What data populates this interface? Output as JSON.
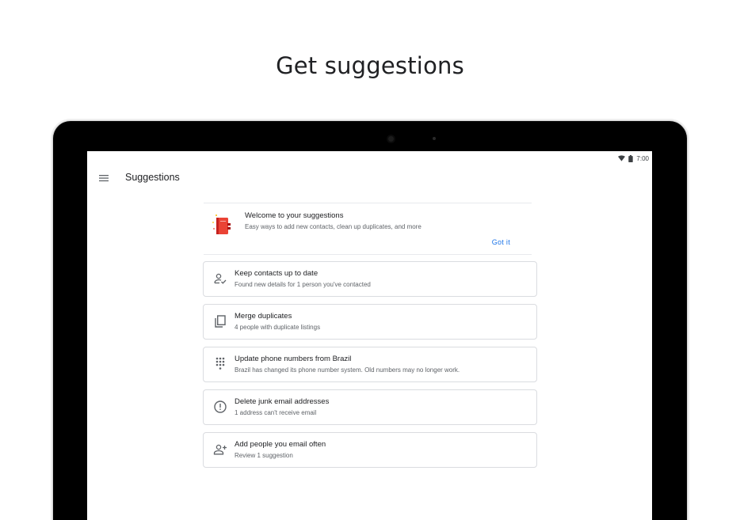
{
  "headline": "Get suggestions",
  "statusbar": {
    "time": "7:00",
    "icons": [
      "wifi-icon",
      "battery-icon"
    ]
  },
  "appbar": {
    "title": "Suggestions",
    "menu_icon": "menu-icon"
  },
  "welcome": {
    "title": "Welcome to your suggestions",
    "subtitle": "Easy ways to add new contacts, clean up duplicates, and more",
    "action": "Got it"
  },
  "suggestions": [
    {
      "icon": "person-check-icon",
      "title": "Keep contacts up to date",
      "subtitle": "Found new details for 1 person you've contacted"
    },
    {
      "icon": "copy-icon",
      "title": "Merge duplicates",
      "subtitle": "4 people with duplicate listings"
    },
    {
      "icon": "dialpad-icon",
      "title": "Update phone numbers from Brazil",
      "subtitle": "Brazil has changed its phone number system. Old numbers may no longer work."
    },
    {
      "icon": "error-outline-icon",
      "title": "Delete junk email addresses",
      "subtitle": "1 address can't receive email"
    },
    {
      "icon": "person-add-icon",
      "title": "Add people you email often",
      "subtitle": "Review 1 suggestion"
    }
  ],
  "colors": {
    "accent": "#1a73e8",
    "illustration_red": "#ea4335",
    "border": "#dadce0"
  }
}
